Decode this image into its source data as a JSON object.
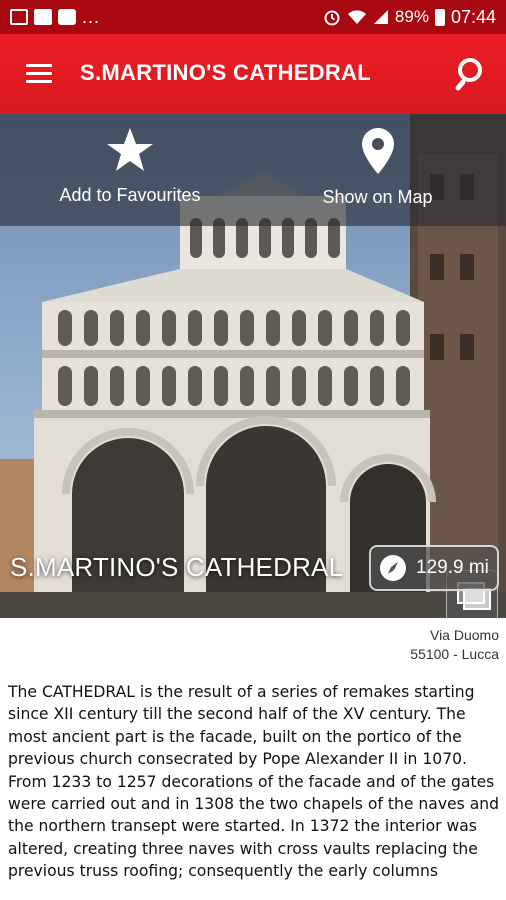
{
  "status_bar": {
    "battery": "89%",
    "time": "07:44",
    "more": "..."
  },
  "app_bar": {
    "title": "S.MARTINO'S CATHEDRAL"
  },
  "actions": {
    "favourites_label": "Add to Favourites",
    "map_label": "Show on Map"
  },
  "hero": {
    "title": "S.MARTINO'S CATHEDRAL",
    "distance": "129.9 mi"
  },
  "address": {
    "street": "Via Duomo",
    "city": "55100 - Lucca"
  },
  "description": "The CATHEDRAL is the result of a series of remakes starting since XII century till the second half of the XV century. The most ancient part is the facade, built on the portico of the previous church consecrated by Pope Alexander II in 1070. From 1233 to 1257 decorations of the facade and of the gates were carried out and in 1308 the two chapels of the naves and the northern transept were started. In 1372 the interior was altered, creating three naves with cross vaults replacing the previous truss roofing; consequently the early columns",
  "colors": {
    "status_bar": "#a80810",
    "app_bar": "#e01b22"
  }
}
